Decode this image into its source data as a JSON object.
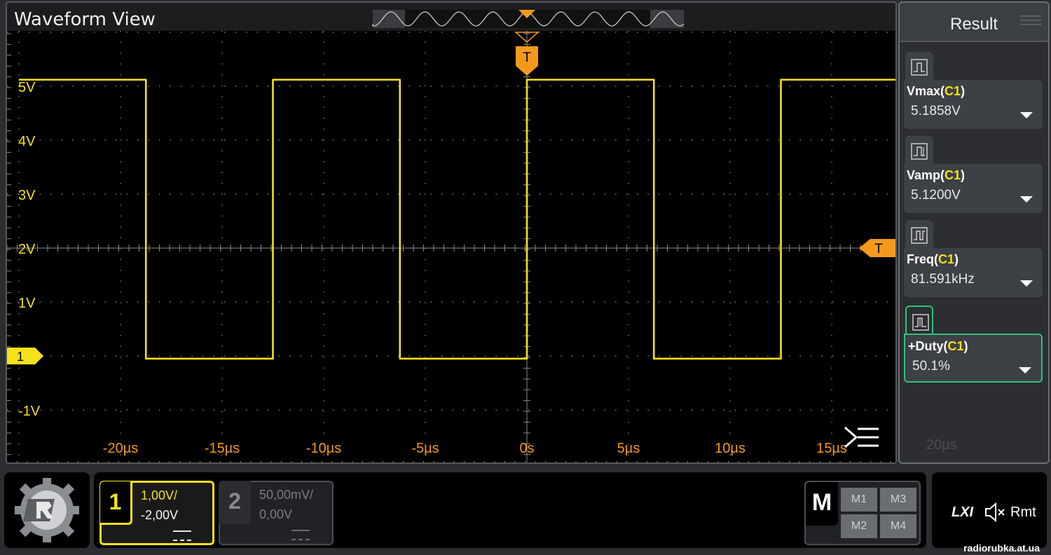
{
  "window": {
    "title": "Waveform View"
  },
  "markers": {
    "trigger_time_label": "T",
    "trigger_level_label": "T",
    "channel_marker": "1"
  },
  "axes": {
    "voltage_labels": [
      "5V",
      "4V",
      "3V",
      "2V",
      "1V",
      "-1V"
    ],
    "time_labels": [
      "-20µs",
      "-15µs",
      "-10µs",
      "-5µs",
      "0s",
      "5µs",
      "10µs",
      "15µs",
      "20µs"
    ]
  },
  "result": {
    "title": "Result",
    "measurements": [
      {
        "name": "Vmax",
        "channel": "C1",
        "value": "5.1858V"
      },
      {
        "name": "Vamp",
        "channel": "C1",
        "value": "5.1200V"
      },
      {
        "name": "Freq",
        "channel": "C1",
        "value": "81.591kHz"
      },
      {
        "name": "+Duty",
        "channel": "C1",
        "value": "50.1%"
      }
    ]
  },
  "channels": [
    {
      "number": "1",
      "scale": "1,00V/",
      "offset": "-2,00V"
    },
    {
      "number": "2",
      "scale": "50,00mV/",
      "offset": "0,00V"
    }
  ],
  "math": {
    "label": "M",
    "buttons": [
      "M1",
      "M3",
      "M2",
      "M4"
    ]
  },
  "status": {
    "lxi": "LXI",
    "remote": "Rmt"
  },
  "watermark": "radiorubka.at.ua",
  "colors": {
    "ch1": "#f5e21a",
    "trigger": "#f39a1e",
    "selected": "#2ec27e",
    "grid": "#7a7a7a"
  }
}
